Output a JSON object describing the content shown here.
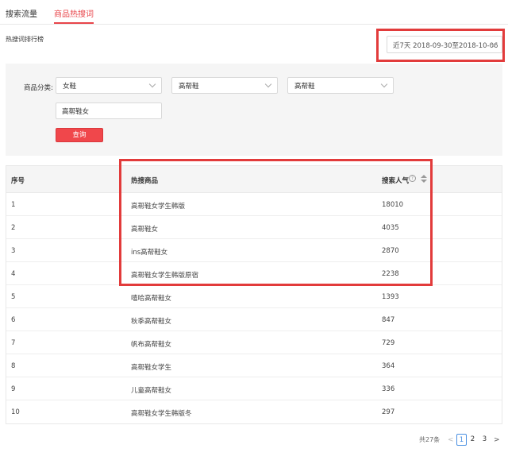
{
  "tabs": [
    {
      "label": "搜索流量"
    },
    {
      "label": "商品热搜词"
    }
  ],
  "section_title": "热搜词排行榜",
  "date_range": "近7天 2018-09-30至2018-10-06",
  "filter": {
    "label": "商品分类:",
    "category1": "女鞋",
    "category2": "高帮鞋",
    "category3": "高帮鞋",
    "keyword_value": "高帮鞋女",
    "query_label": "查询"
  },
  "table": {
    "headers": {
      "rank": "序号",
      "product": "热搜商品",
      "popularity": "搜索人气"
    },
    "rows": [
      {
        "rank": "1",
        "product": "高帮鞋女学生韩版",
        "popularity": "18010"
      },
      {
        "rank": "2",
        "product": "高帮鞋女",
        "popularity": "4035"
      },
      {
        "rank": "3",
        "product": "ins高帮鞋女",
        "popularity": "2870"
      },
      {
        "rank": "4",
        "product": "高帮鞋女学生韩版原宿",
        "popularity": "2238"
      },
      {
        "rank": "5",
        "product": "嘻哈高帮鞋女",
        "popularity": "1393"
      },
      {
        "rank": "6",
        "product": "秋季高帮鞋女",
        "popularity": "847"
      },
      {
        "rank": "7",
        "product": "帆布高帮鞋女",
        "popularity": "729"
      },
      {
        "rank": "8",
        "product": "高帮鞋女学生",
        "popularity": "364"
      },
      {
        "rank": "9",
        "product": "儿童高帮鞋女",
        "popularity": "336"
      },
      {
        "rank": "10",
        "product": "高帮鞋女学生韩版冬",
        "popularity": "297"
      }
    ]
  },
  "pagination": {
    "total": "共27条",
    "pages": [
      "1",
      "2",
      "3"
    ],
    "current": "1",
    "prev": "<",
    "next": ">"
  },
  "icons": {
    "help": "question-circle-icon",
    "sort": "sort-icon",
    "dropdown": "chevron-down-icon"
  },
  "colors": {
    "accent": "#e8454a",
    "highlight_frame": "#e23b3b",
    "active_page": "#4a90e2"
  }
}
